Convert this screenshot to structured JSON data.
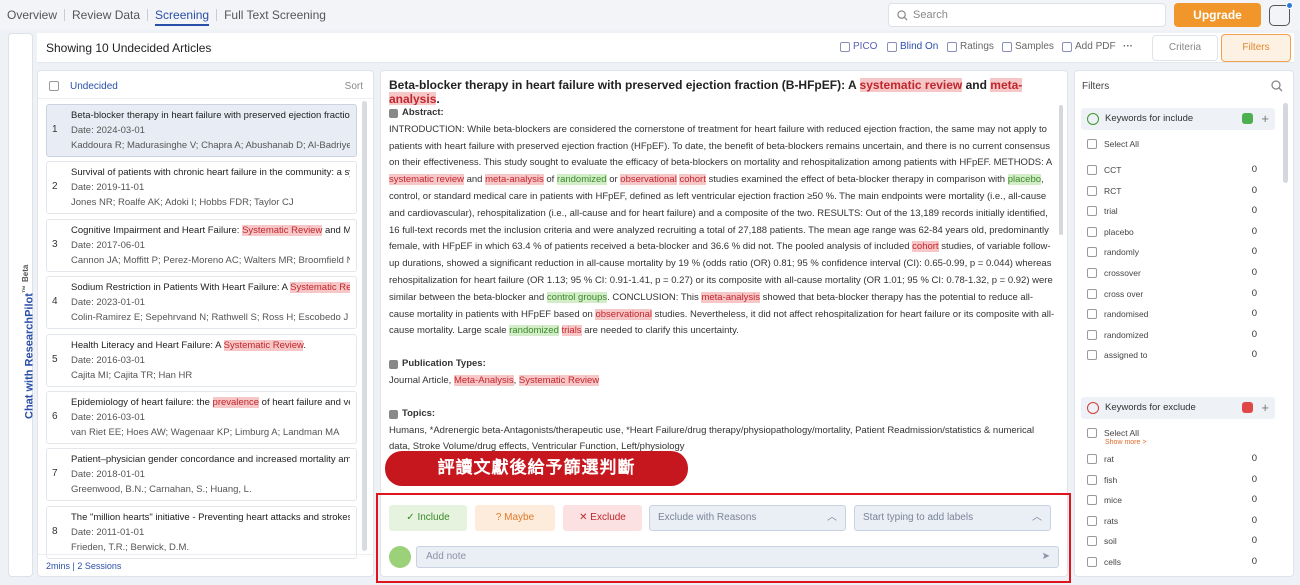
{
  "nav": {
    "tabs": [
      "Overview",
      "Review Data",
      "Screening",
      "Full Text Screening"
    ],
    "active": "Screening"
  },
  "search": {
    "placeholder": "Search"
  },
  "upgrade": "Upgrade",
  "sidechat": {
    "label": "Chat with ResearchPilot",
    "tm": "™",
    "beta": "Beta"
  },
  "header": {
    "title": "Showing 10 Undecided Articles",
    "buttons": [
      "PICO",
      "Blind On",
      "Ratings",
      "Samples",
      "Add PDF",
      "···"
    ],
    "criteria": "Criteria",
    "filters": "Filters"
  },
  "list": {
    "filter": "Undecided",
    "sort": "Sort",
    "footer": "2mins | 2 Sessions",
    "articles": [
      {
        "num": "1",
        "pre": "Beta-blocker therapy in heart failure with preserved ejection fraction (B-HFpEF): A systematic review and meta-analysis.",
        "hl": "",
        "post": "",
        "date": "Date: 2024-03-01",
        "authors": "Kaddoura R; Madurasinghe V; Chapra A; Abushanab D; Al-Badriyeh D"
      },
      {
        "num": "2",
        "pre": "Survival of patients with chronic heart failure in the community: a systematic review",
        "hl": "",
        "post": "",
        "date": "Date: 2019-11-01",
        "authors": "Jones NR; Roalfe AK; Adoki I; Hobbs FDR; Taylor CJ"
      },
      {
        "num": "3",
        "pre": "Cognitive Impairment and Heart Failure: ",
        "hl": "Systematic Review",
        "post": " and Meta-Analysis.",
        "date": "Date: 2017-06-01",
        "authors": "Cannon JA; Moffitt P; Perez-Moreno AC; Walters MR; Broomfield NM"
      },
      {
        "num": "4",
        "pre": "Sodium Restriction in Patients With Heart Failure: A ",
        "hl": "Systematic Review",
        "post": "",
        "date": "Date: 2023-01-01",
        "authors": "Colin-Ramirez E; Sepehrvand N; Rathwell S; Ross H; Escobedo J"
      },
      {
        "num": "5",
        "pre": "Health Literacy and Heart Failure: A ",
        "hl": "Systematic Review",
        "post": ".",
        "date": "Date: 2016-03-01",
        "authors": "Cajita MI; Cajita TR; Han HR"
      },
      {
        "num": "6",
        "pre": "Epidemiology of heart failure: the ",
        "hl": "prevalence",
        "post": " of heart failure and ventricular dysfunction",
        "date": "Date: 2016-03-01",
        "authors": "van Riet EE; Hoes AW; Wagenaar KP; Limburg A; Landman MA"
      },
      {
        "num": "7",
        "pre": "Patient–physician gender concordance and increased mortality among female heart attack patients",
        "hl": "",
        "post": "",
        "date": "Date: 2018-01-01",
        "authors": "Greenwood, B.N.; Carnahan, S.; Huang, L."
      },
      {
        "num": "8",
        "pre": "The \"million hearts\" initiative - Preventing heart attacks and strokes",
        "hl": "",
        "post": "",
        "date": "Date: 2011-01-01",
        "authors": "Frieden, T.R.; Berwick, D.M."
      }
    ]
  },
  "detail": {
    "title_pre": "Beta-blocker therapy in heart failure with preserved ejection fraction (B-HFpEF): A ",
    "title_hl1": "systematic review",
    "title_mid": " and ",
    "title_hl2": "meta-analysis",
    "title_end": ".",
    "abstract_label": "Abstract:",
    "a": [
      "INTRODUCTION: While beta-blockers are considered the cornerstone of treatment for heart failure with reduced ejection fraction, the same may not apply to patients with heart failure with preserved ejection fraction (HFpEF). To date, the benefit of beta-blockers remains uncertain, and there is no current consensus on their effectiveness. This study sought to evaluate the efficacy of beta-blockers on mortality and rehospitalization among patients with HFpEF. METHODS: A ",
      "systematic review",
      " and ",
      "meta-analysis",
      " of ",
      "randomized",
      " or ",
      "observational",
      " ",
      "cohort",
      " studies examined the effect of beta-blocker therapy in comparison with ",
      "placebo",
      ", control, or standard medical care in patients with HFpEF, defined as left ventricular ejection fraction ≥50 %. The main endpoints were mortality (i.e., all-cause and cardiovascular), rehospitalization (i.e., all-cause and for heart failure) and a composite of the two. RESULTS: Out of the 13,189 records initially identified, 16 full-text records met the inclusion criteria and were analyzed recruiting a total of 27,188 patients. The mean age range was 62-84 years old, predominantly female, with HFpEF in which 63.4 % of patients received a beta-blocker and 36.6 % did not. The pooled analysis of included ",
      "cohort",
      " studies, of variable follow-up durations, showed a significant reduction in all-cause mortality by 19 % (odds ratio (OR) 0.81; 95 % confidence interval (CI): 0.65-0.99, p = 0.044) whereas rehospitalization for heart failure (OR 1.13; 95 % CI: 0.91-1.41, p = 0.27) or its composite with all-cause mortality (OR 1.01; 95 % CI: 0.78-1.32, p = 0.92) were similar between the beta-blocker and ",
      "control groups",
      ". CONCLUSION: This ",
      "meta-analysis",
      " showed that beta-blocker therapy has the potential to reduce all-cause mortality in patients with HFpEF based on ",
      "observational",
      " studies. Nevertheless, it did not affect rehospitalization for heart failure or its composite with all-cause mortality. Large scale ",
      "randomized",
      " ",
      "trials",
      " are needed to clarify this uncertainty."
    ],
    "pubtypes_label": "Publication Types:",
    "pub_pre": "Journal Article, ",
    "pub_hl1": "Meta-Analysis",
    ", ": "",
    "pub_sep": ", ",
    "pub_hl2": "Systematic Review",
    "topics_label": "Topics:",
    "topics": "Humans, *Adrenergic beta-Antagonists/therapeutic use, *Heart Failure/drug therapy/physiopathology/mortality, Patient Readmission/statistics & numerical data, Stroke Volume/drug effects, Ventricular Function, Left/physiology"
  },
  "banner": "評讀文獻後給予篩選判斷",
  "actions": {
    "include": "Include",
    "maybe": "Maybe",
    "exclude": "Exclude",
    "reasons": "Exclude with Reasons",
    "labels": "Start typing to add labels",
    "note": "Add note"
  },
  "filters": {
    "title": "Filters",
    "include": {
      "label": "Keywords for include",
      "select_all": "Select All",
      "items": [
        [
          "CCT",
          "0"
        ],
        [
          "RCT",
          "0"
        ],
        [
          "trial",
          "0"
        ],
        [
          "placebo",
          "0"
        ],
        [
          "randomly",
          "0"
        ],
        [
          "crossover",
          "0"
        ],
        [
          "cross over",
          "0"
        ],
        [
          "randomised",
          "0"
        ],
        [
          "randomized",
          "0"
        ],
        [
          "assigned to",
          "0"
        ]
      ],
      "show_more": "Show more >"
    },
    "exclude": {
      "label": "Keywords for exclude",
      "select_all": "Select All",
      "items": [
        [
          "rat",
          "0"
        ],
        [
          "fish",
          "0"
        ],
        [
          "mice",
          "0"
        ],
        [
          "rats",
          "0"
        ],
        [
          "soil",
          "0"
        ],
        [
          "cells",
          "0"
        ]
      ]
    }
  }
}
